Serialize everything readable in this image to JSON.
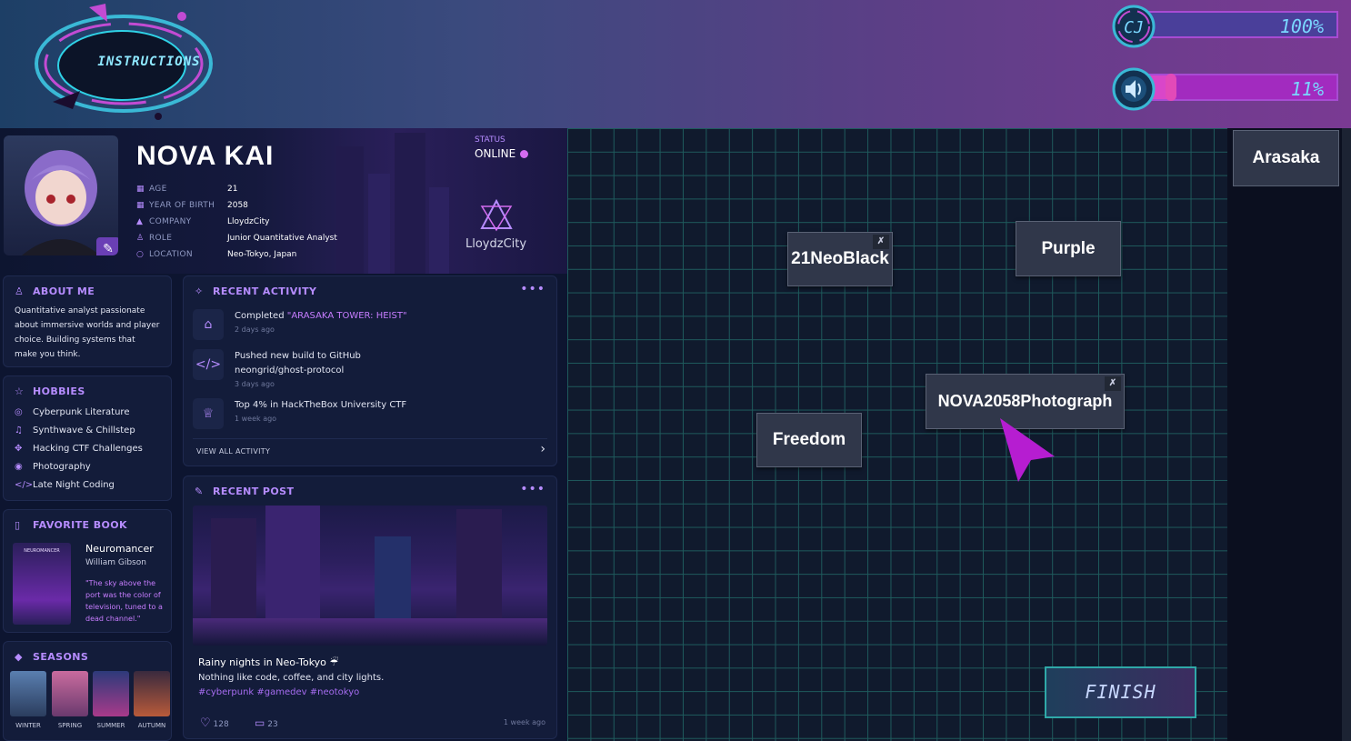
{
  "header": {
    "instructions_label": "INSTRUCTIONS",
    "meters": [
      {
        "icon": "c-letter-icon",
        "label": "CJ",
        "value_text": "100%",
        "level": 1.0
      },
      {
        "icon": "speaker-icon",
        "value_text": "11%",
        "level": 0.11
      }
    ]
  },
  "profile": {
    "name": "NOVA KAI",
    "status_label": "STATUS",
    "status_value": "ONLINE",
    "company_name": "LloydzCity",
    "info": [
      {
        "icon": "calendar-icon",
        "key": "AGE",
        "value": "21"
      },
      {
        "icon": "calendar-icon",
        "key": "YEAR OF BIRTH",
        "value": "2058"
      },
      {
        "icon": "building-icon",
        "key": "COMPANY",
        "value": "LloydzCity"
      },
      {
        "icon": "user-icon",
        "key": "ROLE",
        "value": "Junior Quantitative Analyst"
      },
      {
        "icon": "location-pin-icon",
        "key": "LOCATION",
        "value": "Neo-Tokyo, Japan"
      }
    ],
    "about": {
      "title": "ABOUT ME",
      "text": "Quantitative analyst passionate about immersive worlds and player choice. Building systems that make you think."
    },
    "hobbies": {
      "title": "HOBBIES",
      "items": [
        {
          "icon": "book-icon",
          "label": "Cyberpunk Literature"
        },
        {
          "icon": "music-icon",
          "label": "Synthwave & Chillstep"
        },
        {
          "icon": "puzzle-icon",
          "label": "Hacking CTF Challenges"
        },
        {
          "icon": "camera-icon",
          "label": "Photography"
        },
        {
          "icon": "code-icon",
          "label": "Late Night Coding"
        }
      ]
    },
    "book": {
      "title": "FAVORITE BOOK",
      "cover_text": "NEUROMANCER",
      "name": "Neuromancer",
      "author": "William Gibson",
      "quote": "\"The sky above the port was the color of television, tuned to a dead channel.\""
    },
    "seasons": {
      "title": "SEASONS",
      "items": [
        "WINTER",
        "SPRING",
        "SUMMER",
        "AUTUMN"
      ]
    },
    "activity": {
      "title": "RECENT ACTIVITY",
      "items": [
        {
          "icon": "gamepad-icon",
          "prefix": "Completed ",
          "highlight": "\"ARASAKA TOWER: HEIST\"",
          "line2": "",
          "time": "2 days ago"
        },
        {
          "icon": "code-icon",
          "prefix": "Pushed new build to GitHub",
          "highlight": "",
          "line2": "neongrid/ghost-protocol",
          "time": "3 days ago"
        },
        {
          "icon": "trophy-icon",
          "prefix": "Top 4% in HackTheBox University CTF",
          "highlight": "",
          "line2": "",
          "time": "1 week ago"
        }
      ],
      "view_all": "VIEW ALL ACTIVITY"
    },
    "post": {
      "title": "RECENT POST",
      "caption": "Rainy nights in Neo-Tokyo ☔",
      "text": "Nothing like code, coffee, and city lights.",
      "tags": "#cyberpunk #gamedev #neotokyo",
      "likes": "128",
      "comments": "23",
      "time": "1 week ago"
    }
  },
  "board": {
    "tiles": [
      {
        "label": "21NeoBlack",
        "pinned": true
      },
      {
        "label": "Purple",
        "pinned": false
      },
      {
        "label": "NOVA2058Photograph",
        "pinned": true
      },
      {
        "label": "Freedom",
        "pinned": false
      }
    ],
    "finish_label": "FINISH",
    "side_tiles": [
      "Arasaka"
    ]
  },
  "colors": {
    "accent_purple": "#b68cff",
    "grid_line": "#1e5a5c",
    "cursor": "#b61dd1"
  }
}
